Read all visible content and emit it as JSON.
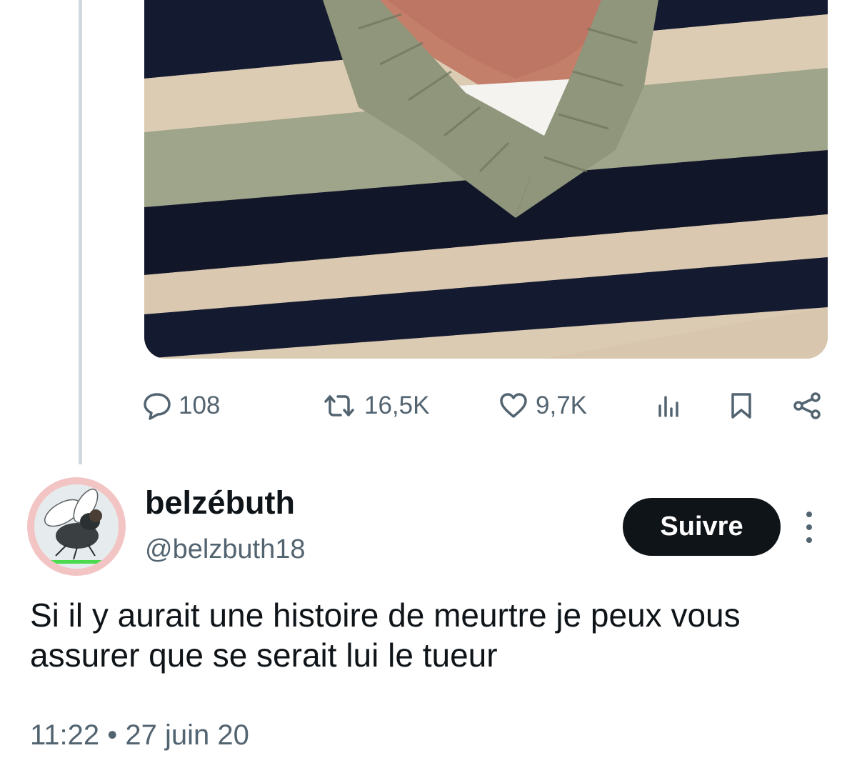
{
  "tweet_stats": {
    "replies": "108",
    "retweets": "16,5K",
    "likes": "9,7K"
  },
  "reply": {
    "display_name": "belzébuth",
    "handle": "@belzbuth18",
    "follow_label": "Suivre",
    "text": "Si il y aurait une histoire de meurtre je peux vous assurer que se serait lui le tueur",
    "timestamp": "11:22 • 27 juin 20"
  },
  "icons": {
    "reply": "comment-bubble-icon",
    "retweet": "retweet-icon",
    "like": "heart-icon",
    "views": "analytics-bars-icon",
    "bookmark": "bookmark-icon",
    "share": "share-icon",
    "more": "vertical-dots-icon"
  },
  "colors": {
    "text_primary": "#0f1419",
    "text_secondary": "#536471",
    "thread_line": "#cfd9de",
    "follow_button_bg": "#0f1419",
    "follow_button_text": "#ffffff",
    "avatar_ring": "#f3c4c4"
  }
}
